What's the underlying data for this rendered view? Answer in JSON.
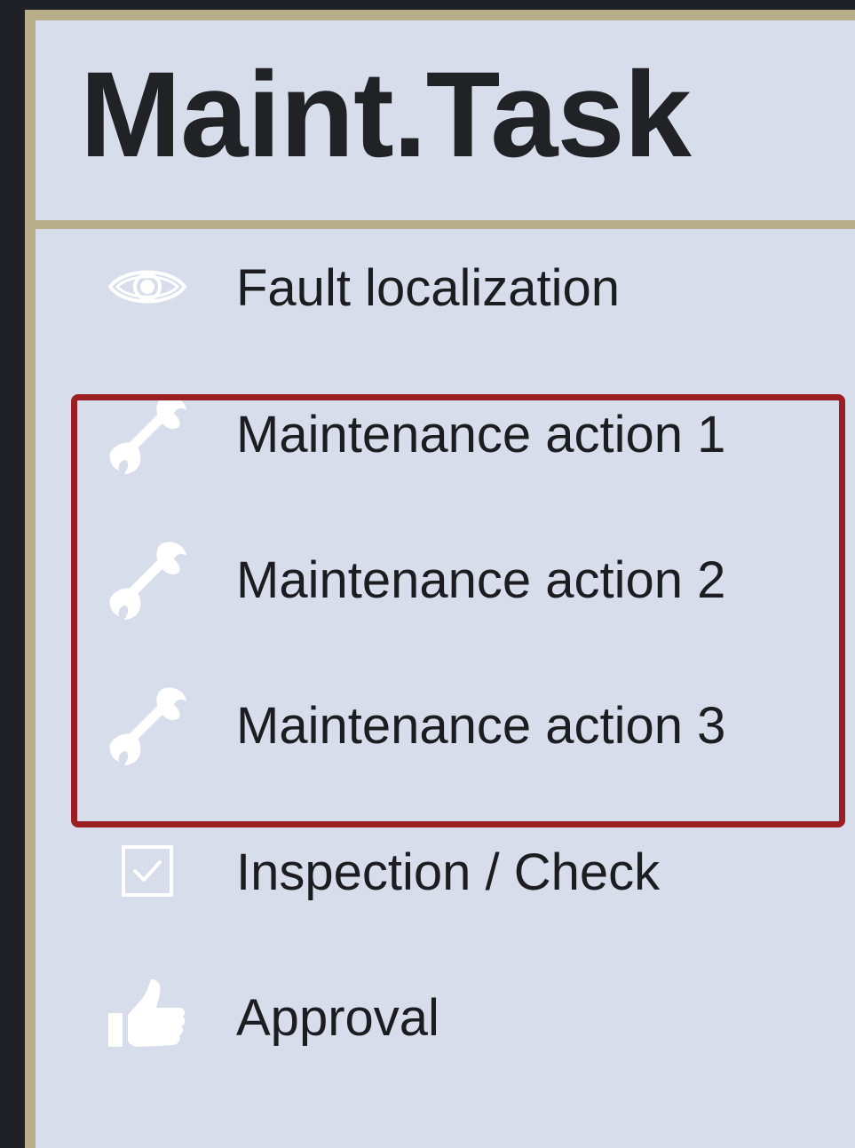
{
  "header": {
    "title": "Maint.Task"
  },
  "menu": {
    "items": [
      {
        "label": "Fault localization",
        "icon": "eye-icon"
      },
      {
        "label": "Maintenance action 1",
        "icon": "wrench-icon"
      },
      {
        "label": "Maintenance action 2",
        "icon": "wrench-icon"
      },
      {
        "label": "Maintenance action 3",
        "icon": "wrench-icon"
      },
      {
        "label": "Inspection / Check",
        "icon": "checkbox-icon"
      },
      {
        "label": "Approval",
        "icon": "thumbs-up-icon"
      }
    ]
  },
  "colors": {
    "background": "#1f2127",
    "frame": "#b9ae8a",
    "panel": "#d8ddeb",
    "title_text": "#202226",
    "item_text": "#1c1d21",
    "icon": "#ffffff",
    "highlight_border": "#9b1e22"
  }
}
